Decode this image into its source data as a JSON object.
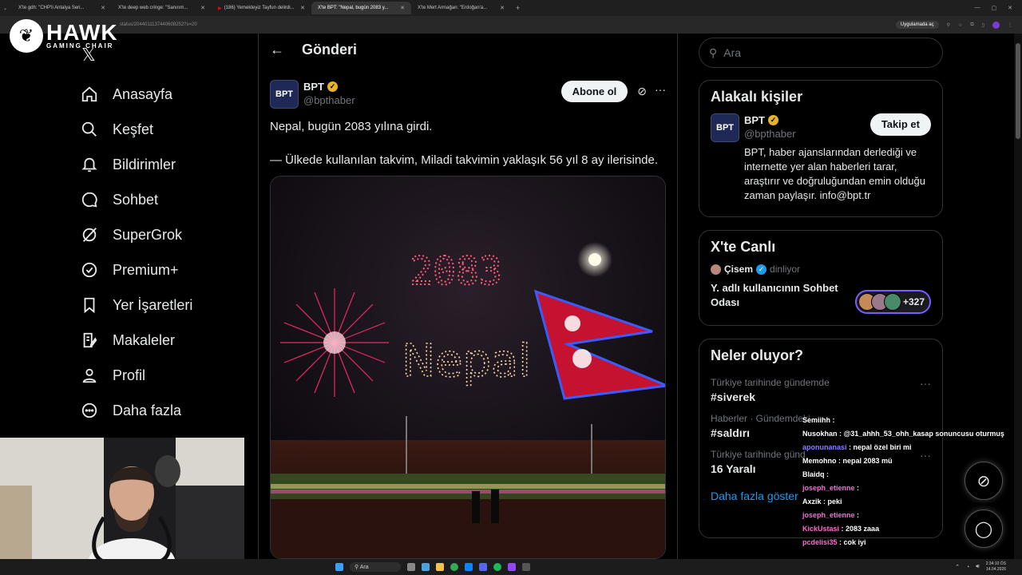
{
  "browser": {
    "tabs": [
      {
        "title": "X'te gdh: \"CHP'li Antalya Seri...",
        "active": false
      },
      {
        "title": "X'te deep web cringe: \"Sanırım...",
        "active": false
      },
      {
        "title": "(186) Yemekteyiz Tayfun delirdi...",
        "active": false
      },
      {
        "title": "X'te BPT: \"Nepal, bugün 2083 y...",
        "active": true
      },
      {
        "title": "X'te Mert Armağan: \"Erdoğan'a...",
        "active": false
      }
    ],
    "url": "status/2044011137440608252?s=20",
    "app_button": "Uygulamada aç"
  },
  "overlay_logo": {
    "title": "HAWK",
    "subtitle": "GAMING CHAIR"
  },
  "sidebar": {
    "items": [
      {
        "label": "Anasayfa",
        "icon": "home-icon"
      },
      {
        "label": "Keşfet",
        "icon": "search-icon"
      },
      {
        "label": "Bildirimler",
        "icon": "bell-icon"
      },
      {
        "label": "Sohbet",
        "icon": "chat-icon"
      },
      {
        "label": "SuperGrok",
        "icon": "grok-icon"
      },
      {
        "label": "Premium+",
        "icon": "verified-icon"
      },
      {
        "label": "Yer İşaretleri",
        "icon": "bookmark-icon"
      },
      {
        "label": "Makaleler",
        "icon": "article-icon"
      },
      {
        "label": "Profil",
        "icon": "profile-icon"
      },
      {
        "label": "Daha fazla",
        "icon": "more-circle-icon"
      }
    ]
  },
  "main": {
    "header_title": "Gönderi",
    "author": {
      "avatar_text": "BPT",
      "name": "BPT",
      "handle": "@bpthaber"
    },
    "subscribe_label": "Abone ol",
    "text_lines": [
      "Nepal, bugün 2083 yılına girdi.",
      "— Ülkede kullanılan takvim, Miladi takvimin yaklaşık 56 yıl 8 ay ilerisinde."
    ],
    "image_texts": {
      "year": "2083",
      "word": "Nepal"
    }
  },
  "right": {
    "search_placeholder": "Ara",
    "related": {
      "title": "Alakalı kişiler",
      "avatar_text": "BPT",
      "name": "BPT",
      "handle": "@bpthaber",
      "follow_label": "Takip et",
      "bio": "BPT, haber ajanslarından derlediği ve internette yer alan haberleri tarar, araştırır ve doğruluğundan emin olduğu zaman paylaşır. info@bpt.tr"
    },
    "live": {
      "title": "X'te Canlı",
      "host": "Çisem",
      "status": "dinliyor",
      "room": "Y. adlı kullanıcının Sohbet Odası",
      "count": "+327"
    },
    "trends": {
      "title": "Neler oluyor?",
      "items": [
        {
          "context": "Türkiye tarihinde gündemde",
          "topic": "#siverek"
        },
        {
          "context": "Haberler · Gündemdeki",
          "topic": "#saldırı"
        },
        {
          "context": "Türkiye tarihinde günd",
          "topic": "16 Yaralı"
        }
      ],
      "show_more": "Daha fazla göster"
    }
  },
  "chat": [
    {
      "user": "Semiihh",
      "msg": "",
      "color": "#ffffff"
    },
    {
      "user": "Nusokhan",
      "msg": "@31_ahhh_53_ohh_kasap sonuncusu oturmuş",
      "color": "#ffffff"
    },
    {
      "user": "aponunanasi",
      "msg": "nepal özel biri mi",
      "color": "#8a7dff"
    },
    {
      "user": "Memohno",
      "msg": "nepal 2083 mü",
      "color": "#ffffff"
    },
    {
      "user": "Blaidq",
      "msg": "",
      "color": "#ffffff"
    },
    {
      "user": "joseph_etienne",
      "msg": "",
      "color": "#ff6ad5"
    },
    {
      "user": "Axzik",
      "msg": "peki",
      "color": "#ffffff"
    },
    {
      "user": "joseph_etienne",
      "msg": "",
      "color": "#ff6ad5"
    },
    {
      "user": "KickUstasi",
      "msg": "2083 zaaa",
      "color": "#ff6ad5"
    },
    {
      "user": "pcdelisi35",
      "msg": "cok iyi",
      "color": "#ff6ad5"
    },
    {
      "user": "Semiihh",
      "msg": "",
      "color": "#ffffff"
    }
  ],
  "taskbar": {
    "search": "Ara",
    "time": "2:34:10 ÖS",
    "date": "14.04.2026"
  },
  "colors": {
    "accent": "#1d9bf0",
    "gold": "#e8b22b",
    "bg": "#000000"
  }
}
